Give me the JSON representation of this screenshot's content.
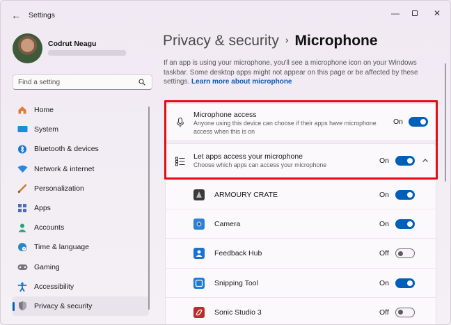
{
  "window": {
    "title": "Settings"
  },
  "user": {
    "name": "Codrut Neagu"
  },
  "search": {
    "placeholder": "Find a setting"
  },
  "sidebar": {
    "items": [
      {
        "label": "Home",
        "icon": "home-icon",
        "color": "#e07b39"
      },
      {
        "label": "System",
        "icon": "system-icon",
        "color": "#1a8fd6"
      },
      {
        "label": "Bluetooth & devices",
        "icon": "bluetooth-icon",
        "color": "#1677d6"
      },
      {
        "label": "Network & internet",
        "icon": "wifi-icon",
        "color": "#2a86e0"
      },
      {
        "label": "Personalization",
        "icon": "brush-icon",
        "color": "#d2782a"
      },
      {
        "label": "Apps",
        "icon": "apps-icon",
        "color": "#4a6fb8"
      },
      {
        "label": "Accounts",
        "icon": "person-icon",
        "color": "#25a27a"
      },
      {
        "label": "Time & language",
        "icon": "globe-clock-icon",
        "color": "#2a86c8"
      },
      {
        "label": "Gaming",
        "icon": "gamepad-icon",
        "color": "#7a7480"
      },
      {
        "label": "Accessibility",
        "icon": "accessibility-icon",
        "color": "#1670c8"
      },
      {
        "label": "Privacy & security",
        "icon": "shield-icon",
        "color": "#7d7785",
        "active": true
      }
    ]
  },
  "breadcrumb": {
    "parent": "Privacy & security",
    "separator": "›",
    "current": "Microphone"
  },
  "intro": {
    "text": "If an app is using your microphone, you'll see a microphone icon on your Windows taskbar. Some desktop apps might not appear on this page or be affected by these settings. ",
    "link": "Learn more about microphone"
  },
  "mic_access": {
    "title": "Microphone access",
    "description": "Anyone using this device can choose if their apps have microphone access when this is on",
    "state": "On",
    "enabled": true
  },
  "apps_access": {
    "title": "Let apps access your microphone",
    "description": "Choose which apps can access your microphone",
    "state": "On",
    "enabled": true
  },
  "apps": [
    {
      "name": "ARMOURY CRATE",
      "state": "On",
      "enabled": true,
      "icon": "armoury-crate-icon",
      "color": "#3a3a3a"
    },
    {
      "name": "Camera",
      "state": "On",
      "enabled": true,
      "icon": "camera-icon",
      "color": "#2f7fd4"
    },
    {
      "name": "Feedback Hub",
      "state": "Off",
      "enabled": false,
      "icon": "feedback-hub-icon",
      "color": "#1a73d0"
    },
    {
      "name": "Snipping Tool",
      "state": "On",
      "enabled": true,
      "icon": "snipping-tool-icon",
      "color": "#1b7ad6"
    },
    {
      "name": "Sonic Studio 3",
      "state": "Off",
      "enabled": false,
      "icon": "sonic-studio-icon",
      "color": "#c0282e"
    }
  ],
  "colors": {
    "accent": "#005fb8",
    "highlight": "#e10c14"
  }
}
